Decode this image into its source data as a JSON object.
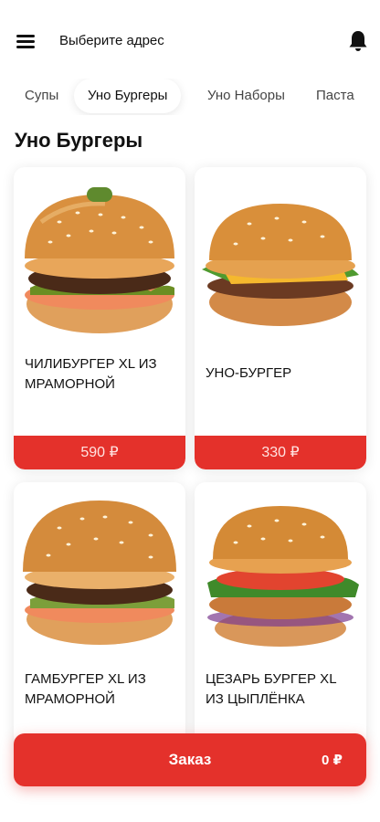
{
  "header": {
    "address_label": "Выберите адрес"
  },
  "tabs": [
    {
      "label": "Супы",
      "active": false
    },
    {
      "label": "Уно Бургеры",
      "active": true
    },
    {
      "label": "Уно Наборы",
      "active": false
    },
    {
      "label": "Паста",
      "active": false
    }
  ],
  "section": {
    "title": "Уно Бургеры"
  },
  "products": [
    {
      "name": "ЧИЛИБУРГЕР XL ИЗ МРАМОРНОЙ",
      "price": "590 ₽",
      "image": "chili-burger-image"
    },
    {
      "name": "УНО-БУРГЕР",
      "price": "330 ₽",
      "image": "cheeseburger-image"
    },
    {
      "name": "ГАМБУРГЕР XL ИЗ МРАМОРНОЙ",
      "price": "",
      "image": "hamburger-image"
    },
    {
      "name": "ЦЕЗАРЬ БУРГЕР XL ИЗ ЦЫПЛЁНКА",
      "price": "",
      "image": "caesar-burger-image"
    }
  ],
  "order": {
    "label": "Заказ",
    "total": "0 ₽"
  },
  "colors": {
    "accent": "#e4312b",
    "bun": "#d9903f",
    "background": "#ffffff"
  }
}
